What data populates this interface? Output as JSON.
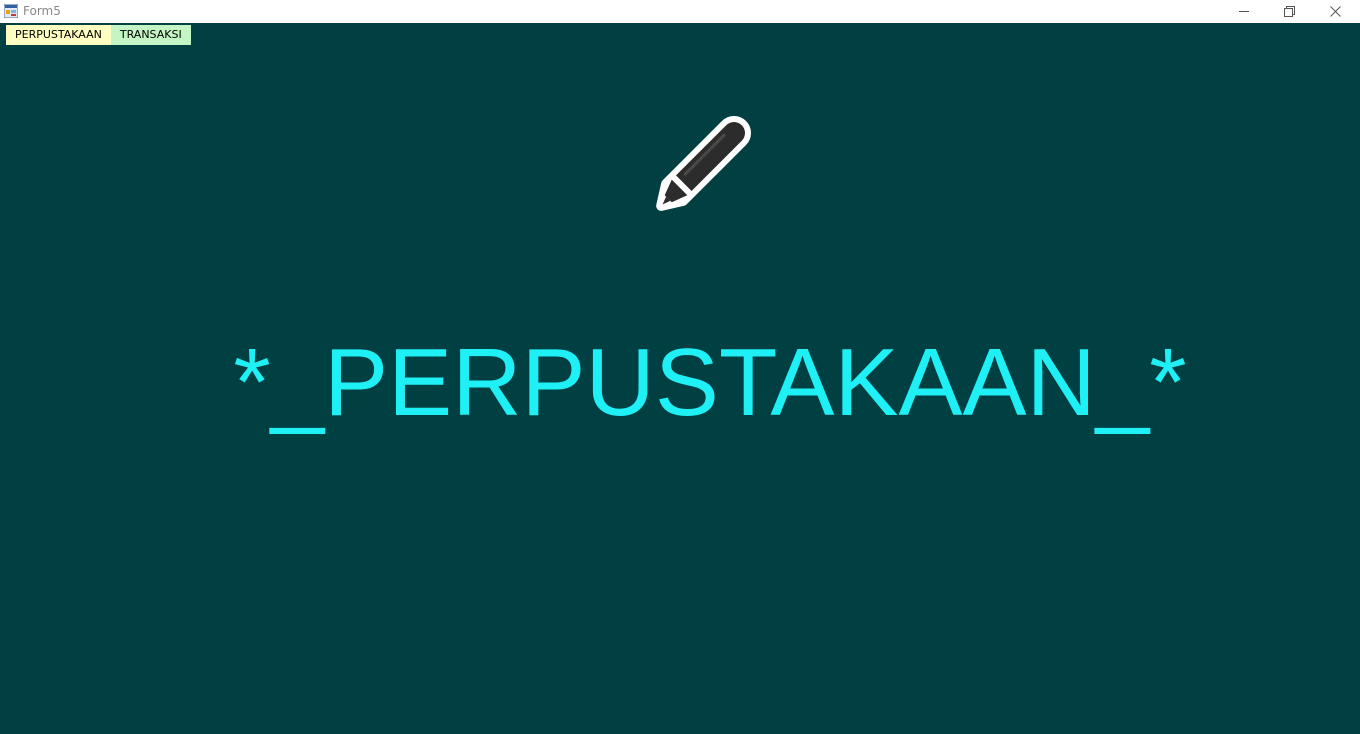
{
  "window": {
    "title": "Form5",
    "icon": "form-app-icon",
    "controls": [
      "minimize-icon",
      "restore-icon",
      "close-icon"
    ]
  },
  "menu": {
    "items": [
      {
        "label": "PERPUSTAKAAN",
        "color": "#ffffc2"
      },
      {
        "label": "TRANSAKSI",
        "color": "#c4f5c4"
      }
    ]
  },
  "main": {
    "icon": "pen-icon",
    "heading": "*_PERPUSTAKAAN_*"
  },
  "colors": {
    "background": "#003f42",
    "heading": "#1ef0f5"
  }
}
